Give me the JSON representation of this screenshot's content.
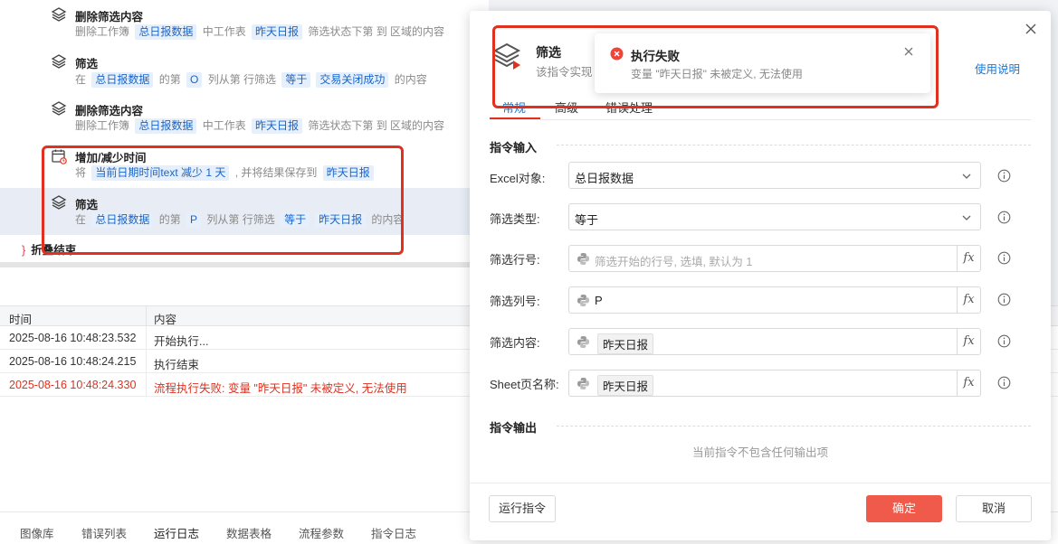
{
  "commands": [
    {
      "title": "删除筛选内容",
      "parts": [
        {
          "t": "删除工作簿"
        },
        {
          "chip": "总日报数据"
        },
        {
          "t": "中工作表"
        },
        {
          "chip": "昨天日报"
        },
        {
          "t": "筛选状态下第 到 区域的内容"
        }
      ]
    },
    {
      "title": "筛选",
      "parts": [
        {
          "t": "在"
        },
        {
          "chip": "总日报数据"
        },
        {
          "t": "的第"
        },
        {
          "chip": "O"
        },
        {
          "t": "列从第  行筛选"
        },
        {
          "chip": "等于"
        },
        {
          "chip": "交易关闭成功"
        },
        {
          "t": "的内容"
        }
      ]
    },
    {
      "title": "删除筛选内容",
      "parts": [
        {
          "t": "删除工作簿"
        },
        {
          "chip": "总日报数据"
        },
        {
          "t": "中工作表"
        },
        {
          "chip": "昨天日报"
        },
        {
          "t": "筛选状态下第 到 区域的内容"
        }
      ]
    },
    {
      "title": "增加/减少时间",
      "parts": [
        {
          "t": "将"
        },
        {
          "chip": "当前日期时间text 减少 1 天"
        },
        {
          "t": ", 并将结果保存到"
        },
        {
          "chip": "昨天日报"
        }
      ]
    },
    {
      "title": "筛选",
      "parts": [
        {
          "t": "在"
        },
        {
          "chip": "总日报数据"
        },
        {
          "t": "的第"
        },
        {
          "chip": "P"
        },
        {
          "t": "列从第  行筛选"
        },
        {
          "chip": "等于"
        },
        {
          "chip": "昨天日报"
        },
        {
          "t": "的内容"
        }
      ]
    }
  ],
  "fold_end": "折叠结束",
  "log": {
    "headers": {
      "time": "时间",
      "content": "内容"
    },
    "rows": [
      {
        "time": "2025-08-16 10:48:23.532",
        "content": "开始执行..."
      },
      {
        "time": "2025-08-16 10:48:24.215",
        "content": "执行结束"
      },
      {
        "time": "2025-08-16 10:48:24.330",
        "content": "流程执行失败: 变量 \"昨天日报\" 未被定义, 无法使用"
      }
    ]
  },
  "bottom_tabs": [
    "图像库",
    "错误列表",
    "运行日志",
    "数据表格",
    "流程参数",
    "指令日志"
  ],
  "dialog": {
    "title": "筛选",
    "subtitle": "该指令实现",
    "help": "使用说明",
    "tabs": [
      "常规",
      "高级",
      "错误处理"
    ],
    "input_section": "指令输入",
    "output_section": "指令输出",
    "fields": {
      "excel_label": "Excel对象:",
      "excel_value": "总日报数据",
      "type_label": "筛选类型:",
      "type_value": "等于",
      "row_label": "筛选行号:",
      "row_placeholder": "筛选开始的行号, 选填, 默认为 1",
      "col_label": "筛选列号:",
      "col_value": "P",
      "content_label": "筛选内容:",
      "content_value": "昨天日报",
      "sheet_label": "Sheet页名称:",
      "sheet_value": "昨天日报"
    },
    "no_output": "当前指令不包含任何输出项",
    "run_button": "运行指令",
    "confirm_button": "确定",
    "cancel_button": "取消"
  },
  "toast": {
    "title": "执行失败",
    "message": "变量 \"昨天日报\" 未被定义, 无法使用"
  },
  "colors": {
    "accent": "#1677d9",
    "danger": "#e0301e",
    "primary_button": "#f05a4a"
  },
  "icons": {
    "cmd": "excel-layers-icon",
    "time": "calendar-clock-icon",
    "python": "python-icon",
    "info": "info-circle-icon",
    "error": "error-circle-icon",
    "close": "close-icon"
  }
}
